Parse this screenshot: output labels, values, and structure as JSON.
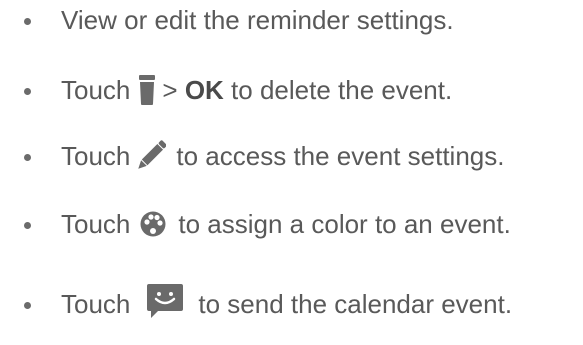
{
  "bullets": [
    {
      "before": "View or edit the reminder settings.",
      "icon": null,
      "after": ""
    },
    {
      "before": "Touch",
      "icon": "trash-icon",
      "after_plain_1": "> ",
      "after_bold": "OK",
      "after_plain_2": " to delete the event."
    },
    {
      "before": "Touch",
      "icon": "pencil-icon",
      "after": "to access the event settings."
    },
    {
      "before": "Touch",
      "icon": "palette-icon",
      "after": "to assign a color to an event."
    },
    {
      "before": "Touch",
      "icon": "share-message-icon",
      "after": "to send the calendar event."
    }
  ],
  "colors": {
    "text": "#595959",
    "icon": "#6a6a6a"
  }
}
